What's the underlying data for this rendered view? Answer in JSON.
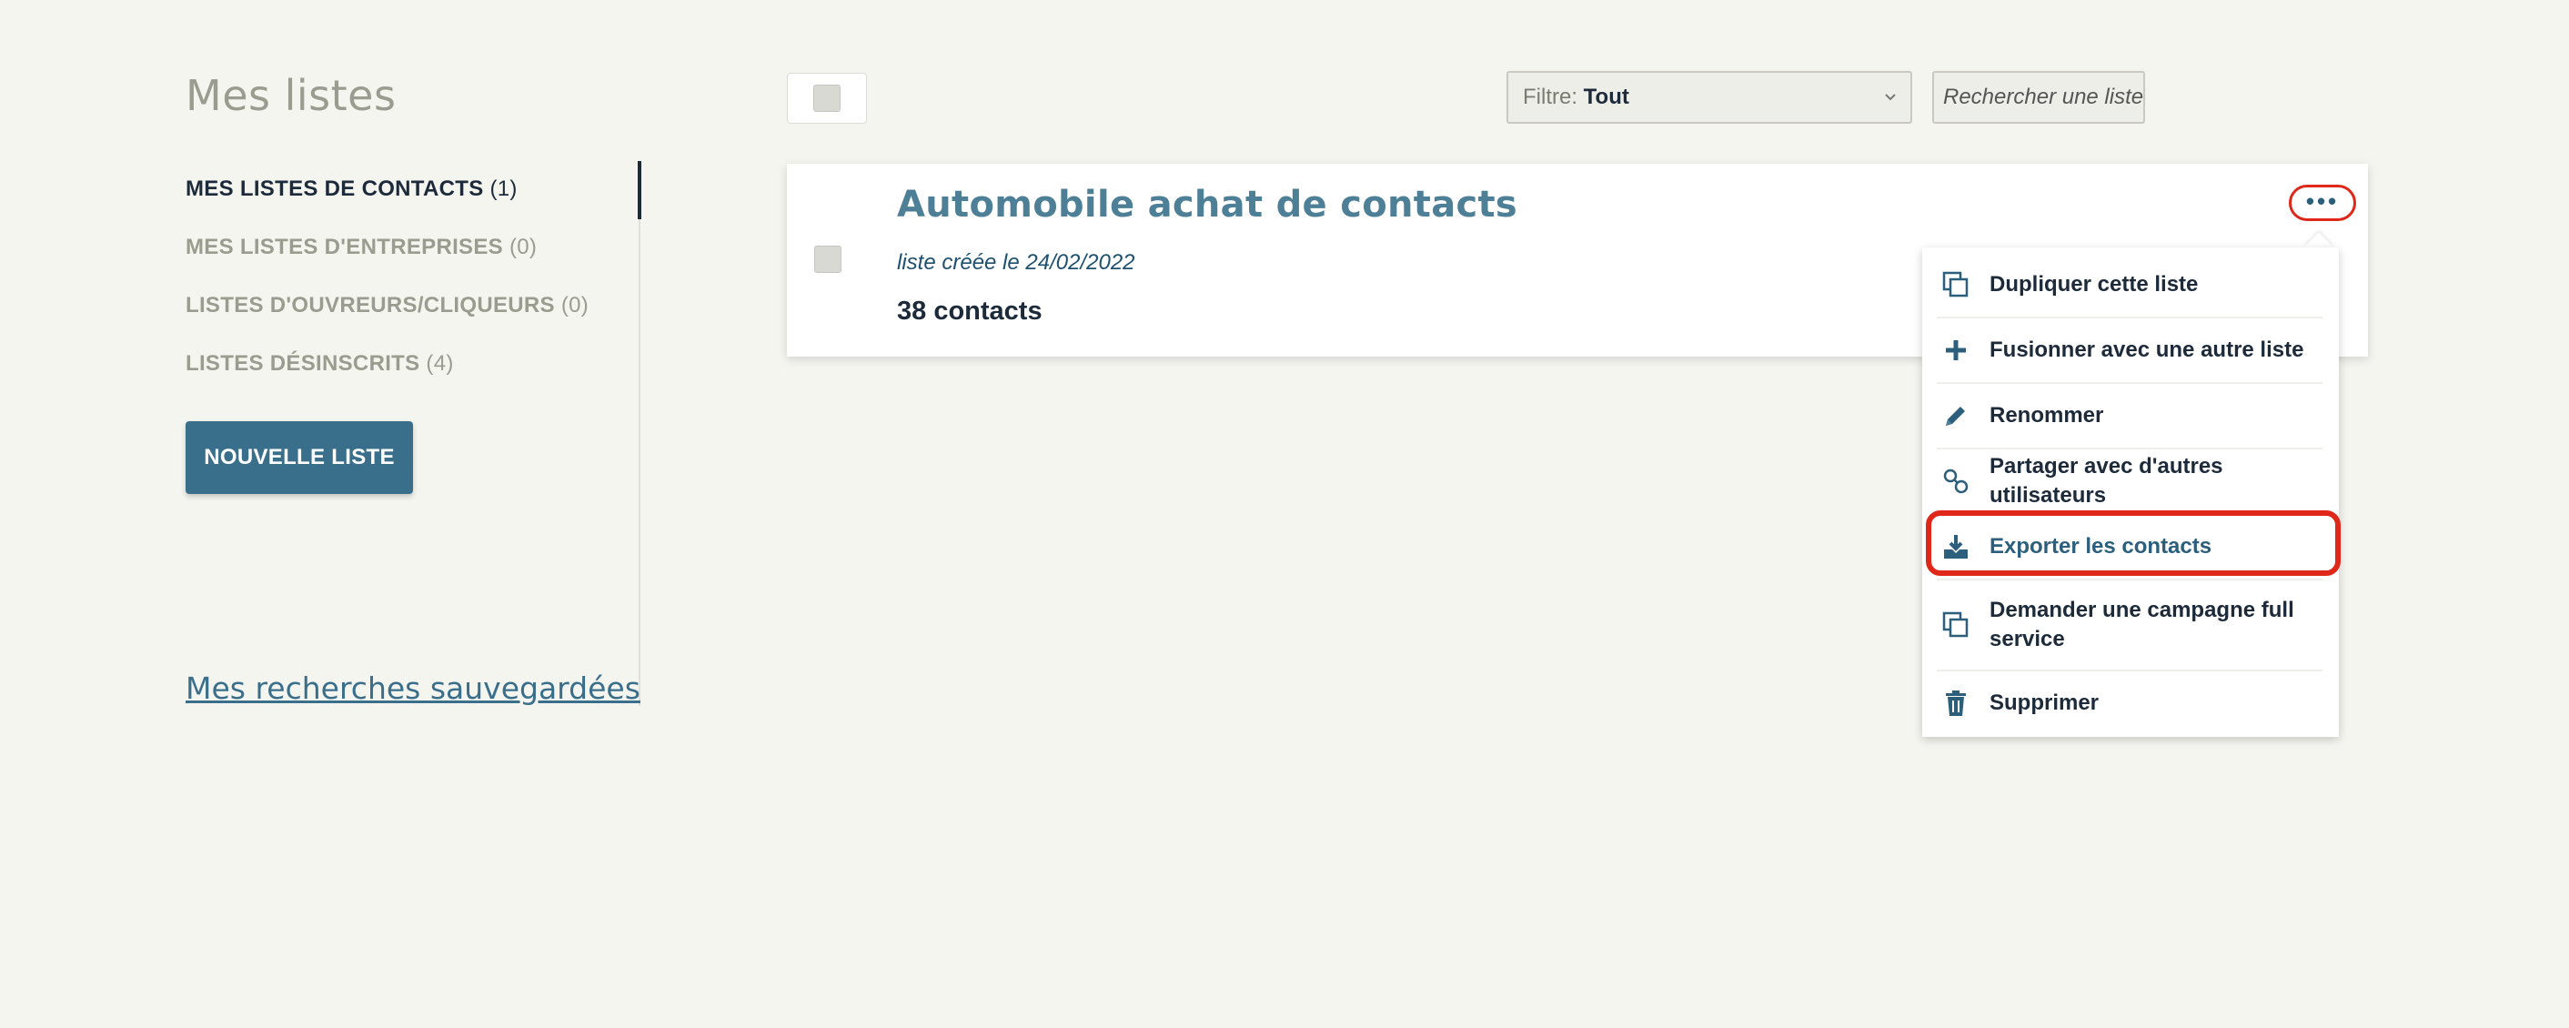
{
  "page_title": "Mes listes",
  "sidebar": {
    "items": [
      {
        "label": "MES LISTES DE CONTACTS",
        "count": "(1)"
      },
      {
        "label": "MES LISTES D'ENTREPRISES",
        "count": "(0)"
      },
      {
        "label": "LISTES D'OUVREURS/CLIQUEURS",
        "count": "(0)"
      },
      {
        "label": "LISTES DÉSINSCRITS",
        "count": "(4)"
      }
    ],
    "new_list_label": "NOUVELLE LISTE",
    "saved_searches_label": "Mes recherches sauvegardées"
  },
  "toolbar": {
    "filter_label": "Filtre:",
    "filter_value": "Tout",
    "search_text": "Rechercher une liste"
  },
  "card": {
    "title": "Automobile achat de contacts",
    "date": "liste créée le 24/02/2022",
    "count": "38 contacts",
    "more_label": "•••"
  },
  "menu": {
    "items": [
      {
        "label": "Dupliquer cette liste",
        "icon": "copy-icon"
      },
      {
        "label": "Fusionner avec une autre liste",
        "icon": "plus-icon"
      },
      {
        "label": "Renommer",
        "icon": "pencil-icon"
      },
      {
        "label": "Partager avec d'autres utilisateurs",
        "icon": "link-icon"
      },
      {
        "label": "Exporter les contacts",
        "icon": "download-icon"
      },
      {
        "label": "Demander une campagne full service",
        "icon": "copy-icon"
      },
      {
        "label": "Supprimer",
        "icon": "trash-icon"
      }
    ]
  },
  "colors": {
    "accent": "#3a6f8c",
    "highlight": "#e0281a",
    "text_dark": "#1c2a3a",
    "muted": "#9a9c8f"
  }
}
